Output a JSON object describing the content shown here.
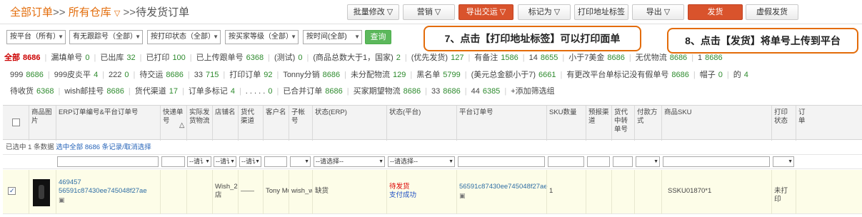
{
  "breadcrumb": {
    "part1": "全部订单",
    "sep1": ">>",
    "part2": "所有仓库",
    "arrow": "▽",
    "sep2": ">>",
    "part3": "待发货订单"
  },
  "toolbar": {
    "batch_edit": "批量修改 ▽",
    "mark_sale": "营销 ▽",
    "export_send": "导出交运 ▽",
    "mark_as": "标记为 ▽",
    "print_label": "打印地址标签",
    "export": "导出 ▽",
    "ship": "发货",
    "fake_ship": "虚假发货"
  },
  "filters": {
    "platform": "按平台（所有）",
    "tracking": "有无跟踪号（全部）",
    "print_status": "按打印状态（全部）",
    "buyer_level": "按买家等级（全部）",
    "time": "按时间(全部)",
    "query": "查询"
  },
  "callouts": {
    "step7": "7、点击【打印地址标签】可以打印面单",
    "step8": "8、点击【发货】将单号上传到平台"
  },
  "stats": {
    "row1": [
      {
        "label": "全部",
        "num": "8686",
        "first": true
      },
      {
        "label": "漏填单号",
        "num": "0"
      },
      {
        "label": "已出库",
        "num": "32"
      },
      {
        "label": "已打印",
        "num": "100"
      },
      {
        "label": "已上传跟单号",
        "num": "6368"
      },
      {
        "label": "(测试)",
        "num": "0"
      },
      {
        "label": "(商品总数大于1，国家)",
        "num": "2"
      },
      {
        "label": "(优先发货)",
        "num": "127"
      },
      {
        "label": "有备注",
        "num": "1586"
      },
      {
        "label": "14",
        "num": "8655"
      },
      {
        "label": "小于7美金",
        "num": "8686"
      },
      {
        "label": "无优物流",
        "num": "8686"
      },
      {
        "label": "1",
        "num": "8686"
      }
    ],
    "row2": [
      {
        "label": "999",
        "num": "8686"
      },
      {
        "label": "999皮炎平",
        "num": "4"
      },
      {
        "label": "222",
        "num": "0"
      },
      {
        "label": "待交运",
        "num": "8686"
      },
      {
        "label": "33",
        "num": "715"
      },
      {
        "label": "打印订单",
        "num": "92"
      },
      {
        "label": "Tonny分销",
        "num": "8686"
      },
      {
        "label": "未分配物流",
        "num": "129"
      },
      {
        "label": "黑名单",
        "num": "5799"
      },
      {
        "label": "(美元总金额小于7)",
        "num": "6661"
      },
      {
        "label": "有更改平台单标记没有假单号",
        "num": "8686"
      },
      {
        "label": "帽子",
        "num": "0"
      },
      {
        "label": "的",
        "num": "4"
      }
    ],
    "row3": [
      {
        "label": "待收货",
        "num": "6368"
      },
      {
        "label": "wish邮挂号",
        "num": "8686"
      },
      {
        "label": "货代渠道",
        "num": "17"
      },
      {
        "label": "订单多标记",
        "num": "4"
      },
      {
        "label": ". . . . .",
        "num": "0"
      },
      {
        "label": "已合并订单",
        "num": "8686"
      },
      {
        "label": "买家期望物流",
        "num": "8686"
      },
      {
        "label": "33",
        "num": "8686"
      },
      {
        "label": "44",
        "num": "6385"
      },
      {
        "label": "+添加筛选组",
        "num": ""
      }
    ]
  },
  "table": {
    "headers": {
      "img": "商品图片",
      "order_no": "ERP订单编号&平台订单号",
      "express_no": "快递单号",
      "actual_logistics": "实际发货物流",
      "shop": "店铺名",
      "freight_channel": "货代渠道",
      "customer": "客户名",
      "sub_account": "子帐号",
      "status_erp": "状态(ERP)",
      "status_platform": "状态(平台)",
      "platform_order": "平台订单号",
      "sku_qty": "SKU数量",
      "rule_channel": "预报渠道",
      "freight_transfer": "货代中转单号",
      "payment": "付款方式",
      "product_sku": "商品SKU",
      "print_status": "打印状态",
      "last": "订单"
    },
    "selected_bar": {
      "prefix": "已选中",
      "count": "1",
      "suffix": "条数据",
      "select_all": "选中全部 8686 条记录/取消选择"
    },
    "filter_placeholders": {
      "req": "--请讠",
      "select_erp": "--请选择--",
      "select_platform": "--请选择--"
    },
    "row": {
      "erp_no": "469457",
      "platform_no": "56591c87430ee745048f27ae",
      "shop": "Wish_2店",
      "freight_channel": "——",
      "customer": "Tony Mu",
      "sub_account": "wish_wi",
      "status_erp": "缺货",
      "status_platform_1": "待发货",
      "status_platform_2": "支付成功",
      "platform_order": "56591c87430ee745048f27ae",
      "sku_qty": "1",
      "product_sku": "SSKU01870*1",
      "print_status": "未打印"
    }
  }
}
